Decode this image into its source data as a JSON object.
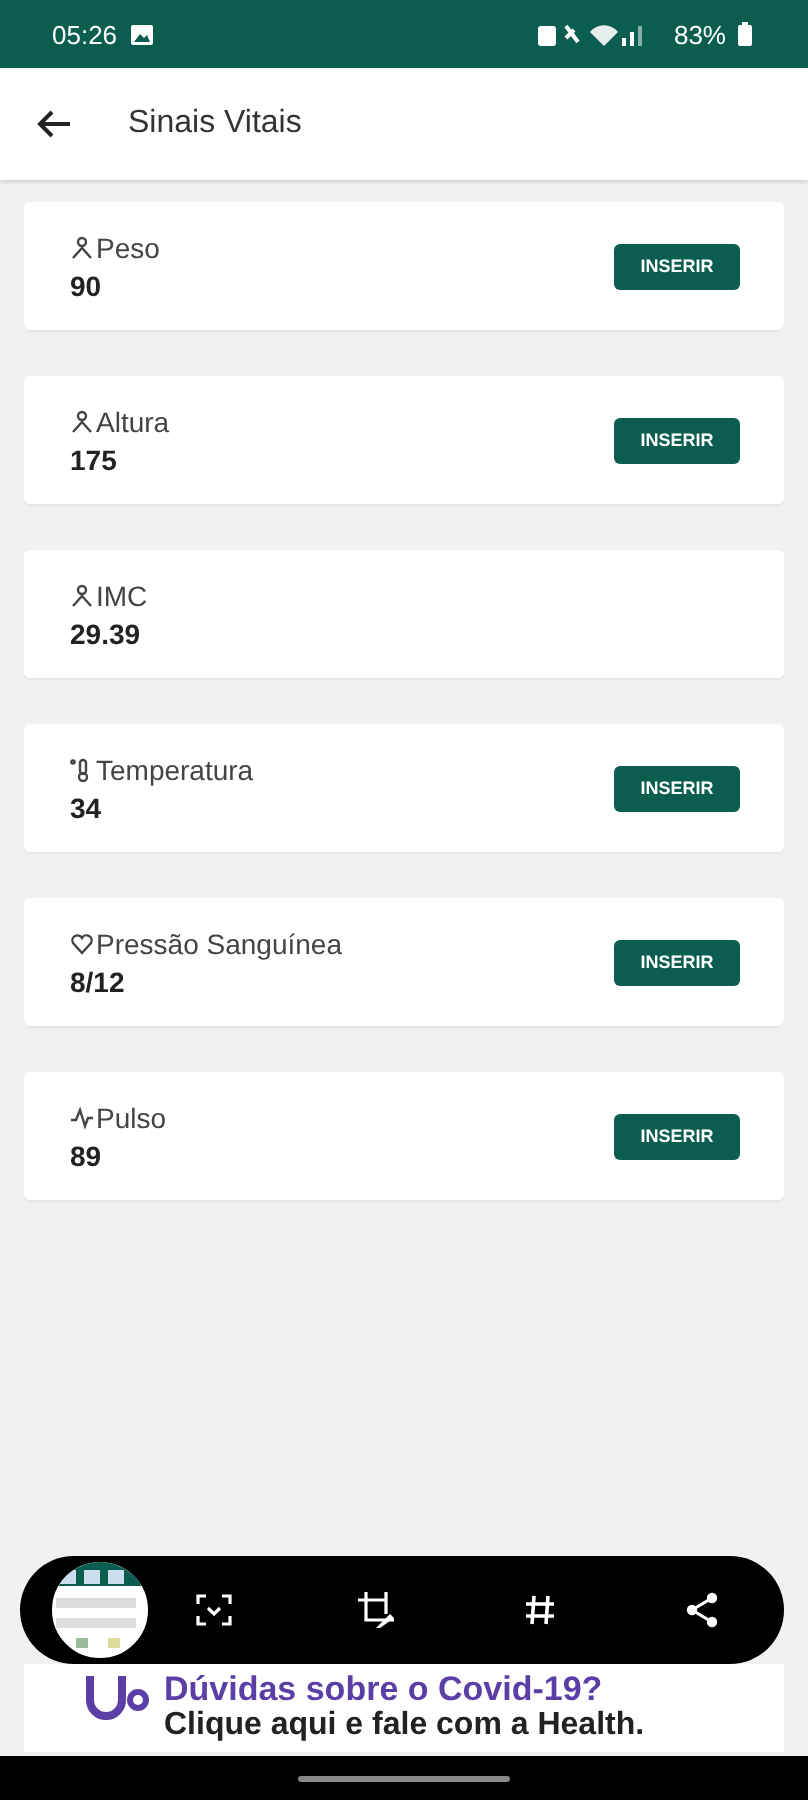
{
  "status_bar": {
    "time": "05:26",
    "battery": "83%"
  },
  "app_bar": {
    "title": "Sinais Vitais"
  },
  "vitals": [
    {
      "kind": "body",
      "label": "Peso",
      "value": "90",
      "button": "INSERIR"
    },
    {
      "kind": "body",
      "label": "Altura",
      "value": "175",
      "button": "INSERIR"
    },
    {
      "kind": "body",
      "label": "IMC",
      "value": "29.39"
    },
    {
      "kind": "temperature",
      "label": "Temperatura",
      "value": "34",
      "button": "INSERIR"
    },
    {
      "kind": "heart",
      "label": "Pressão Sanguínea",
      "value": "8/12",
      "button": "INSERIR"
    },
    {
      "kind": "pulse",
      "label": "Pulso",
      "value": "89",
      "button": "INSERIR"
    }
  ],
  "banner": {
    "headline": "Dúvidas sobre o Covid-19?",
    "text": "Clique aqui e fale com a Health."
  }
}
